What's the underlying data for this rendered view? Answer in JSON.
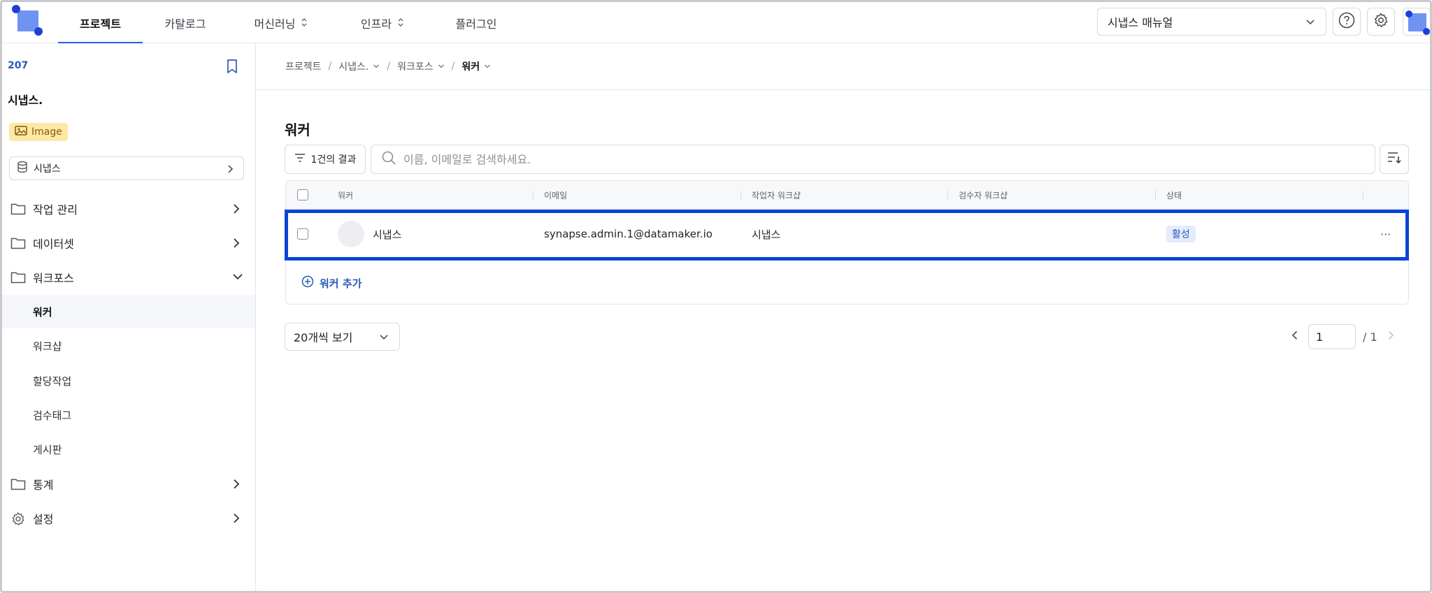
{
  "topbar": {
    "nav": [
      {
        "label": "프로젝트",
        "active": true,
        "has_updown": false
      },
      {
        "label": "카탈로그",
        "active": false,
        "has_updown": false
      },
      {
        "label": "머신러닝",
        "active": false,
        "has_updown": true
      },
      {
        "label": "인프라",
        "active": false,
        "has_updown": true
      },
      {
        "label": "플러그인",
        "active": false,
        "has_updown": false
      }
    ],
    "manual_select": "시냅스 매뉴얼",
    "icons": [
      "help-icon",
      "gear-icon"
    ],
    "accent_color": "#2b5ee3"
  },
  "sidebar": {
    "project_id": "207",
    "project_name": "시냅스.",
    "badge": "Image",
    "dataset": "시냅스",
    "menu": {
      "work": "작업 관리",
      "dataset": "데이터셋",
      "workforce": "워크포스",
      "workforce_sub": [
        "워커",
        "워크샵",
        "할당작업",
        "검수태그",
        "게시판"
      ],
      "stats": "통계",
      "settings": "설정"
    }
  },
  "breadcrumb": [
    "프로젝트",
    "시냅스.",
    "워크포스",
    "워커"
  ],
  "page": {
    "title": "워커",
    "result_count": "1건의 결과",
    "search_placeholder": "이름, 이메일로 검색하세요."
  },
  "table": {
    "columns": [
      "워커",
      "이메일",
      "작업자 워크샵",
      "검수자 워크샵",
      "상태"
    ],
    "rows": [
      {
        "name": "시냅스",
        "email": "synapse.admin.1@datamaker.io",
        "worker_workshop": "시냅스",
        "reviewer_workshop": "",
        "status": "활성"
      }
    ],
    "add_label": "워커 추가",
    "row_menu": "···",
    "highlight_color": "#0a45d6",
    "status_color": "#2b5ab8"
  },
  "pagination": {
    "page_size": "20개씩 보기",
    "current_page": "1",
    "total": "/ 1"
  }
}
